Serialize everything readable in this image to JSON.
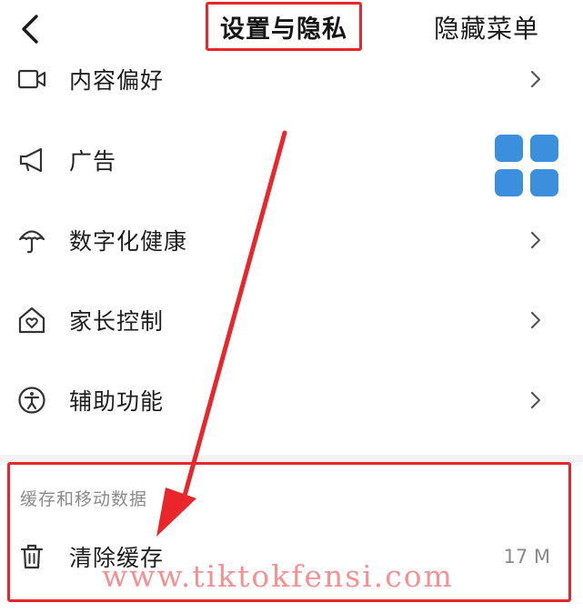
{
  "header": {
    "title": "设置与隐私",
    "hidden_menu": "隐藏菜单"
  },
  "menu_items": [
    {
      "label": "内容偏好",
      "icon": "video-camera-icon"
    },
    {
      "label": "广告",
      "icon": "megaphone-icon"
    },
    {
      "label": "数字化健康",
      "icon": "umbrella-icon"
    },
    {
      "label": "家长控制",
      "icon": "house-heart-icon"
    },
    {
      "label": "辅助功能",
      "icon": "accessibility-icon"
    }
  ],
  "cache_section": {
    "header": "缓存和移动数据",
    "clear_cache_label": "清除缓存",
    "cache_size": "17 M"
  },
  "watermark": "www.tiktokfensi.com",
  "colors": {
    "annotation_red": "#e8262c",
    "grid_icon_blue": "#3b8fdc"
  }
}
